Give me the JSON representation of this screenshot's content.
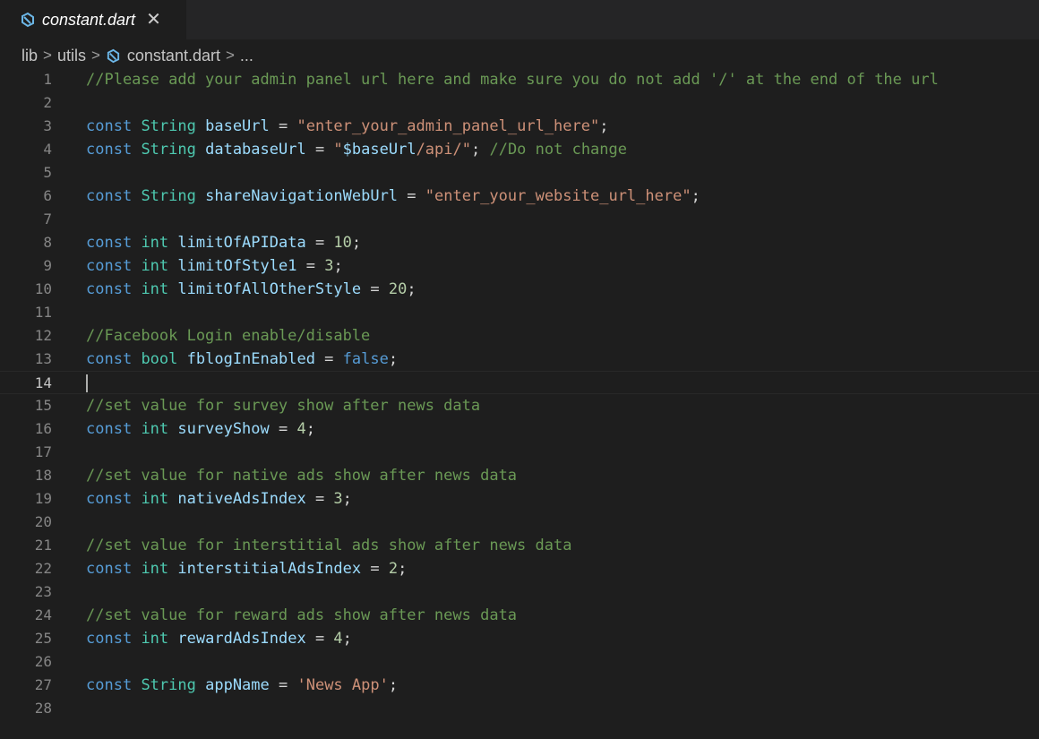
{
  "tab": {
    "title": "constant.dart",
    "close_glyph": "✕",
    "icon": "dart-icon"
  },
  "breadcrumb": {
    "items": [
      "lib",
      "utils",
      "constant.dart",
      "..."
    ],
    "separator": ">"
  },
  "editor": {
    "current_line": 14,
    "lines": [
      {
        "n": "1",
        "tokens": [
          {
            "t": "//Please add your admin panel url here and make sure you do not add '/' at the end of the url",
            "c": "comment"
          }
        ]
      },
      {
        "n": "2",
        "tokens": []
      },
      {
        "n": "3",
        "tokens": [
          {
            "t": "const",
            "c": "keyword"
          },
          {
            "t": " ",
            "c": "op"
          },
          {
            "t": "String",
            "c": "type"
          },
          {
            "t": " ",
            "c": "op"
          },
          {
            "t": "baseUrl",
            "c": "var"
          },
          {
            "t": " = ",
            "c": "op"
          },
          {
            "t": "\"enter_your_admin_panel_url_here\"",
            "c": "string"
          },
          {
            "t": ";",
            "c": "op"
          }
        ]
      },
      {
        "n": "4",
        "tokens": [
          {
            "t": "const",
            "c": "keyword"
          },
          {
            "t": " ",
            "c": "op"
          },
          {
            "t": "String",
            "c": "type"
          },
          {
            "t": " ",
            "c": "op"
          },
          {
            "t": "databaseUrl",
            "c": "var"
          },
          {
            "t": " = ",
            "c": "op"
          },
          {
            "t": "\"",
            "c": "string"
          },
          {
            "t": "$baseUrl",
            "c": "interp"
          },
          {
            "t": "/api/\"",
            "c": "string"
          },
          {
            "t": "; ",
            "c": "op"
          },
          {
            "t": "//Do not change",
            "c": "comment"
          }
        ]
      },
      {
        "n": "5",
        "tokens": []
      },
      {
        "n": "6",
        "tokens": [
          {
            "t": "const",
            "c": "keyword"
          },
          {
            "t": " ",
            "c": "op"
          },
          {
            "t": "String",
            "c": "type"
          },
          {
            "t": " ",
            "c": "op"
          },
          {
            "t": "shareNavigationWebUrl",
            "c": "var"
          },
          {
            "t": " = ",
            "c": "op"
          },
          {
            "t": "\"enter_your_website_url_here\"",
            "c": "string"
          },
          {
            "t": ";",
            "c": "op"
          }
        ]
      },
      {
        "n": "7",
        "tokens": []
      },
      {
        "n": "8",
        "tokens": [
          {
            "t": "const",
            "c": "keyword"
          },
          {
            "t": " ",
            "c": "op"
          },
          {
            "t": "int",
            "c": "type"
          },
          {
            "t": " ",
            "c": "op"
          },
          {
            "t": "limitOfAPIData",
            "c": "var"
          },
          {
            "t": " = ",
            "c": "op"
          },
          {
            "t": "10",
            "c": "number"
          },
          {
            "t": ";",
            "c": "op"
          }
        ]
      },
      {
        "n": "9",
        "tokens": [
          {
            "t": "const",
            "c": "keyword"
          },
          {
            "t": " ",
            "c": "op"
          },
          {
            "t": "int",
            "c": "type"
          },
          {
            "t": " ",
            "c": "op"
          },
          {
            "t": "limitOfStyle1",
            "c": "var"
          },
          {
            "t": " = ",
            "c": "op"
          },
          {
            "t": "3",
            "c": "number"
          },
          {
            "t": ";",
            "c": "op"
          }
        ]
      },
      {
        "n": "10",
        "tokens": [
          {
            "t": "const",
            "c": "keyword"
          },
          {
            "t": " ",
            "c": "op"
          },
          {
            "t": "int",
            "c": "type"
          },
          {
            "t": " ",
            "c": "op"
          },
          {
            "t": "limitOfAllOtherStyle",
            "c": "var"
          },
          {
            "t": " = ",
            "c": "op"
          },
          {
            "t": "20",
            "c": "number"
          },
          {
            "t": ";",
            "c": "op"
          }
        ]
      },
      {
        "n": "11",
        "tokens": []
      },
      {
        "n": "12",
        "tokens": [
          {
            "t": "//Facebook Login enable/disable",
            "c": "comment"
          }
        ]
      },
      {
        "n": "13",
        "tokens": [
          {
            "t": "const",
            "c": "keyword"
          },
          {
            "t": " ",
            "c": "op"
          },
          {
            "t": "bool",
            "c": "type"
          },
          {
            "t": " ",
            "c": "op"
          },
          {
            "t": "fblogInEnabled",
            "c": "var"
          },
          {
            "t": " = ",
            "c": "op"
          },
          {
            "t": "false",
            "c": "keyword"
          },
          {
            "t": ";",
            "c": "op"
          }
        ]
      },
      {
        "n": "14",
        "tokens": []
      },
      {
        "n": "15",
        "tokens": [
          {
            "t": "//set value for survey show after news data",
            "c": "comment"
          }
        ]
      },
      {
        "n": "16",
        "tokens": [
          {
            "t": "const",
            "c": "keyword"
          },
          {
            "t": " ",
            "c": "op"
          },
          {
            "t": "int",
            "c": "type"
          },
          {
            "t": " ",
            "c": "op"
          },
          {
            "t": "surveyShow",
            "c": "var"
          },
          {
            "t": " = ",
            "c": "op"
          },
          {
            "t": "4",
            "c": "number"
          },
          {
            "t": ";",
            "c": "op"
          }
        ]
      },
      {
        "n": "17",
        "tokens": []
      },
      {
        "n": "18",
        "tokens": [
          {
            "t": "//set value for native ads show after news data",
            "c": "comment"
          }
        ]
      },
      {
        "n": "19",
        "tokens": [
          {
            "t": "const",
            "c": "keyword"
          },
          {
            "t": " ",
            "c": "op"
          },
          {
            "t": "int",
            "c": "type"
          },
          {
            "t": " ",
            "c": "op"
          },
          {
            "t": "nativeAdsIndex",
            "c": "var"
          },
          {
            "t": " = ",
            "c": "op"
          },
          {
            "t": "3",
            "c": "number"
          },
          {
            "t": ";",
            "c": "op"
          }
        ]
      },
      {
        "n": "20",
        "tokens": []
      },
      {
        "n": "21",
        "tokens": [
          {
            "t": "//set value for interstitial ads show after news data",
            "c": "comment"
          }
        ]
      },
      {
        "n": "22",
        "tokens": [
          {
            "t": "const",
            "c": "keyword"
          },
          {
            "t": " ",
            "c": "op"
          },
          {
            "t": "int",
            "c": "type"
          },
          {
            "t": " ",
            "c": "op"
          },
          {
            "t": "interstitialAdsIndex",
            "c": "var"
          },
          {
            "t": " = ",
            "c": "op"
          },
          {
            "t": "2",
            "c": "number"
          },
          {
            "t": ";",
            "c": "op"
          }
        ]
      },
      {
        "n": "23",
        "tokens": []
      },
      {
        "n": "24",
        "tokens": [
          {
            "t": "//set value for reward ads show after news data",
            "c": "comment"
          }
        ]
      },
      {
        "n": "25",
        "tokens": [
          {
            "t": "const",
            "c": "keyword"
          },
          {
            "t": " ",
            "c": "op"
          },
          {
            "t": "int",
            "c": "type"
          },
          {
            "t": " ",
            "c": "op"
          },
          {
            "t": "rewardAdsIndex",
            "c": "var"
          },
          {
            "t": " = ",
            "c": "op"
          },
          {
            "t": "4",
            "c": "number"
          },
          {
            "t": ";",
            "c": "op"
          }
        ]
      },
      {
        "n": "26",
        "tokens": []
      },
      {
        "n": "27",
        "tokens": [
          {
            "t": "const",
            "c": "keyword"
          },
          {
            "t": " ",
            "c": "op"
          },
          {
            "t": "String",
            "c": "type"
          },
          {
            "t": " ",
            "c": "op"
          },
          {
            "t": "appName",
            "c": "var"
          },
          {
            "t": " = ",
            "c": "op"
          },
          {
            "t": "'News App'",
            "c": "string"
          },
          {
            "t": ";",
            "c": "op"
          }
        ]
      },
      {
        "n": "28",
        "tokens": []
      }
    ]
  },
  "colors": {
    "background": "#1e1e1e",
    "keyword": "#569cd6",
    "type": "#4ec9b0",
    "variable": "#9cdcfe",
    "string": "#ce9178",
    "number": "#b5cea8",
    "comment": "#6a9955",
    "dart_icon": "#6cb6e6"
  }
}
